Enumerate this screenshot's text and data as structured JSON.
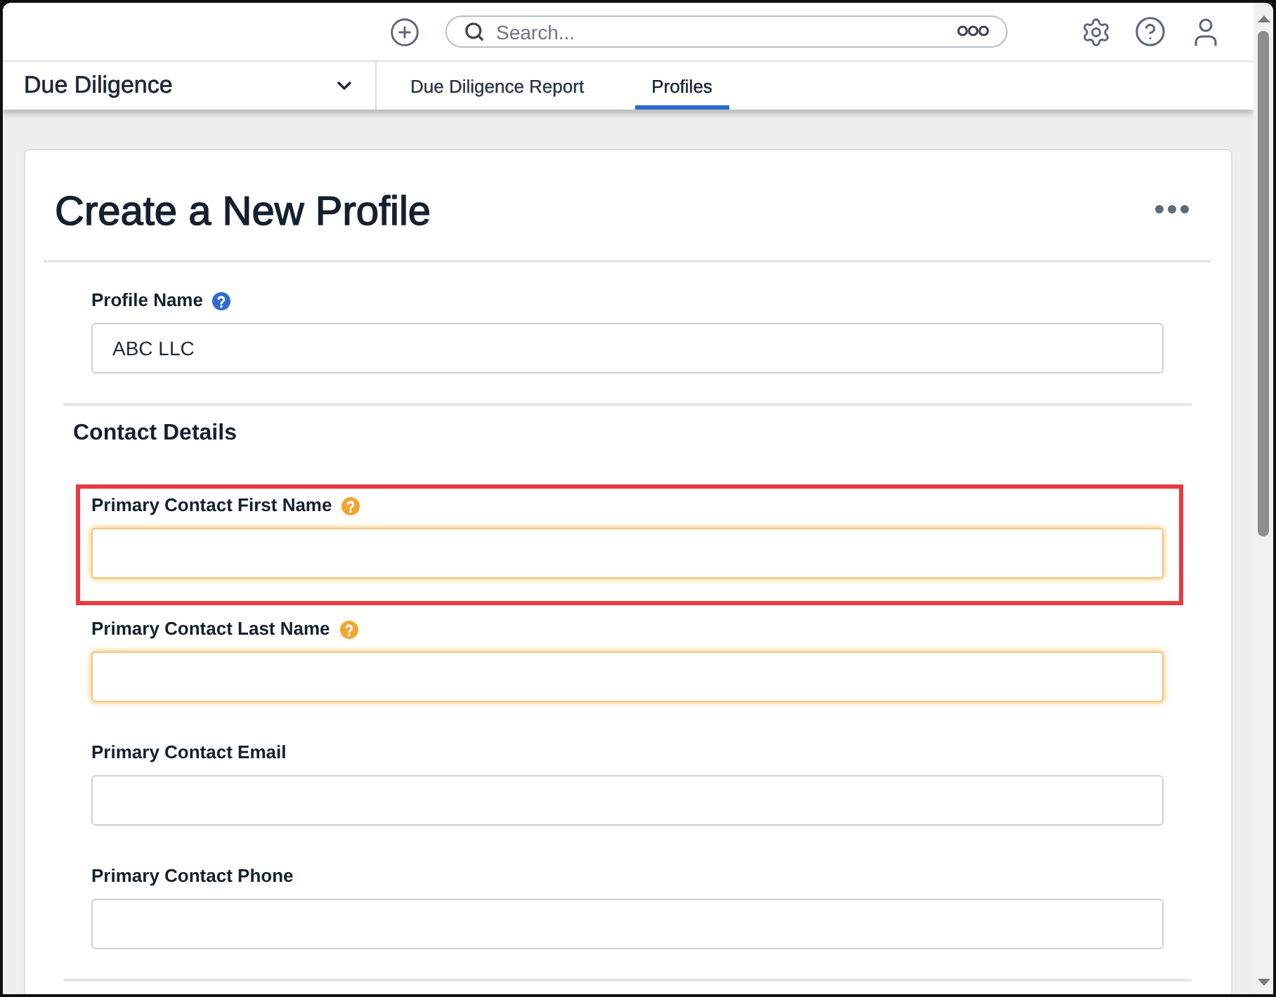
{
  "top_bar": {
    "search": {
      "placeholder": "Search..."
    }
  },
  "nav": {
    "app_selector": {
      "label": "Due Diligence"
    },
    "tabs": [
      {
        "label": "Due Diligence Report",
        "selected": false
      },
      {
        "label": "Profiles",
        "selected": true
      }
    ]
  },
  "form": {
    "title": "Create a New Profile",
    "sections": [
      {
        "fields": [
          {
            "label": "Profile Name",
            "value": "ABC LLC",
            "help_icon": true,
            "required": false,
            "highlighted": false
          }
        ]
      },
      {
        "heading": "Contact Details",
        "fields": [
          {
            "label": "Primary Contact First Name",
            "help_icon": true,
            "required": true,
            "highlighted": true
          },
          {
            "label": "Primary Contact Last Name",
            "help_icon": true,
            "required": true,
            "highlighted": false
          },
          {
            "label": "Primary Contact Email",
            "help_icon": false,
            "required": false,
            "highlighted": false
          },
          {
            "label": "Primary Contact Phone",
            "help_icon": false,
            "required": false,
            "highlighted": false
          }
        ]
      }
    ]
  }
}
